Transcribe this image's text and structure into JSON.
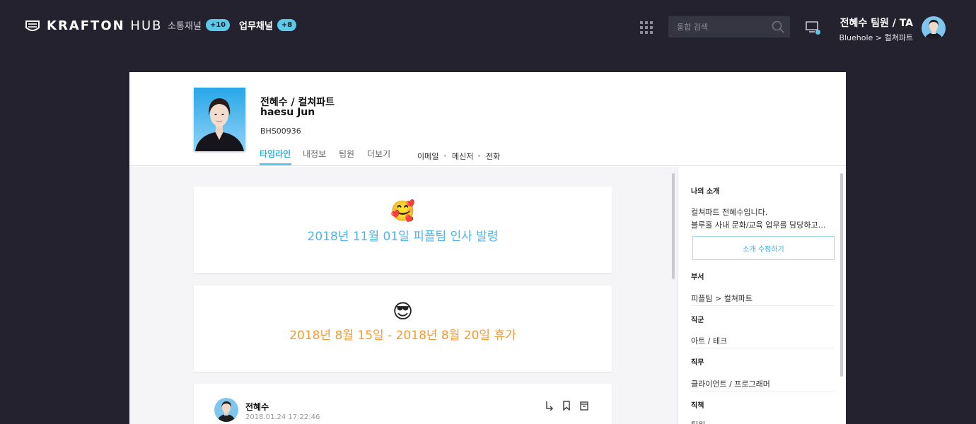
{
  "header": {
    "logo_bold": "KRAFTON",
    "logo_light": "HUB",
    "channels": [
      {
        "label": "소통채널",
        "badge": "+10"
      },
      {
        "label": "업무채널",
        "badge": "+8"
      }
    ],
    "search_placeholder": "통합 검색",
    "user_name": "전혜수 팀원 / TA",
    "user_dept": "Bluehole > 컬쳐파트"
  },
  "profile": {
    "name_kr": "전혜수 / 컬쳐파트",
    "name_en": "haesu Jun",
    "employee_id": "BHS00936",
    "tabs": [
      "타임라인",
      "내정보",
      "팀원",
      "더보기"
    ],
    "contacts": [
      "이메일",
      "메신저",
      "전화"
    ]
  },
  "feed": {
    "events": [
      {
        "emoji": "🥰",
        "text": "2018년 11월 01일 피플팀 인사 발령",
        "color": "#4db5e8"
      },
      {
        "emoji": "😎",
        "text": "2018년 8월 15일 - 2018년 8월 20일 휴가",
        "color": "#f39a35"
      }
    ],
    "post": {
      "author": "전혜수",
      "time": "2018.01.24 17:22:46"
    }
  },
  "side": {
    "intro_title": "나의 소개",
    "intro_line1": "컬쳐파트 전혜수입니다.",
    "intro_line2": "블루홀 사내 문화/교육 업무를 담당하고…",
    "edit_button": "소개 수정하기",
    "fields": [
      {
        "label": "부서",
        "value": "피플팀 > 컬쳐파트"
      },
      {
        "label": "직군",
        "value": "아트 / 테크"
      },
      {
        "label": "직무",
        "value": "클라이언트 / 프로그래머"
      },
      {
        "label": "직책",
        "value": "팀원"
      }
    ]
  },
  "colors": {
    "accent": "#5ec8e9",
    "background": "#23222e"
  }
}
